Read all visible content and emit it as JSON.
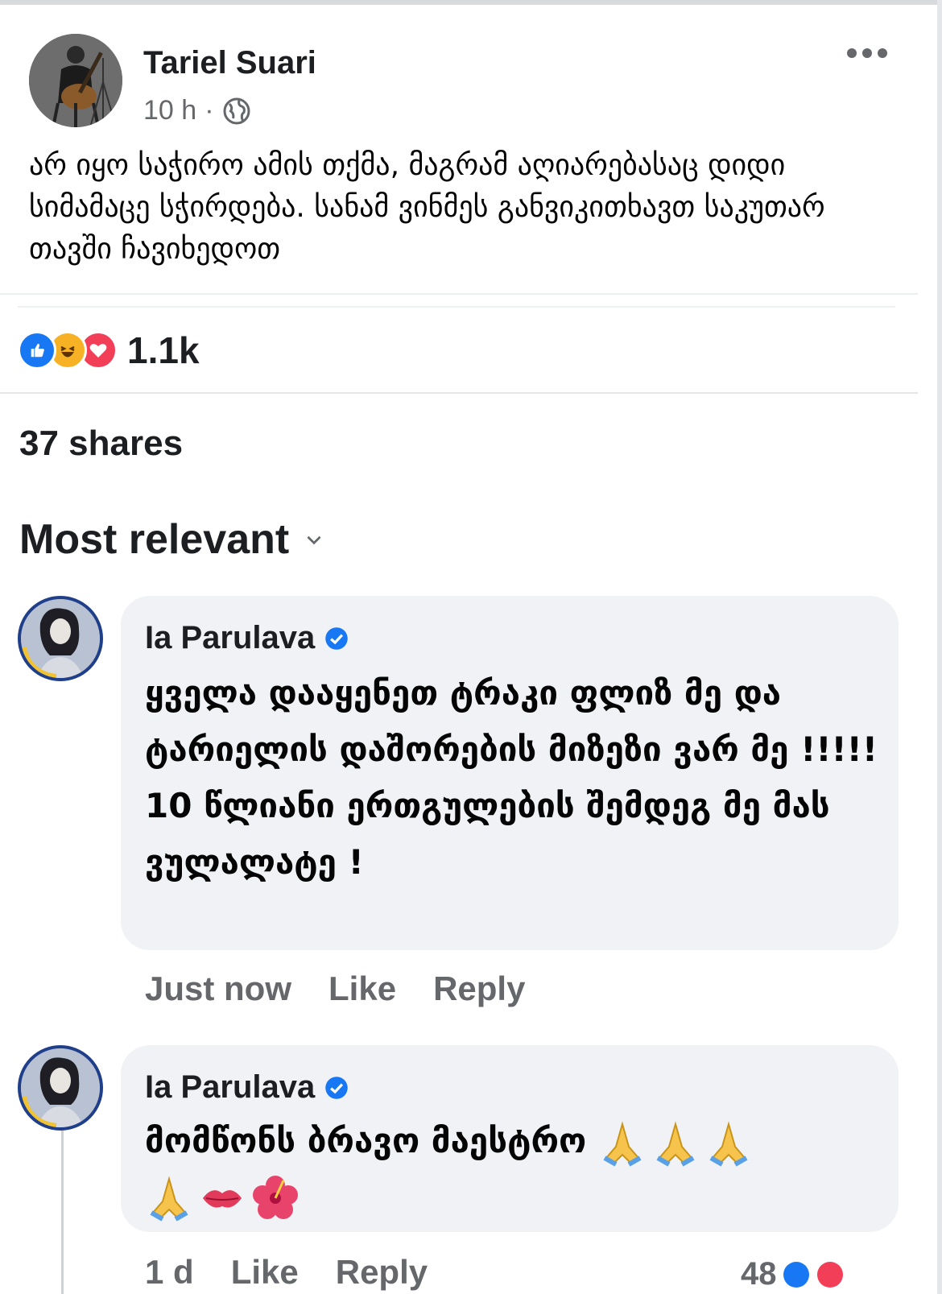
{
  "post": {
    "author": "Tariel Suari",
    "time": "10 h",
    "separator": "·",
    "privacy_icon": "globe-icon",
    "more_icon": "more-horizontal-icon",
    "text": "არ იყო საჭირო ამის თქმა, მაგრამ აღიარებასაც დიდი სიმამაცე სჭირდება. სანამ ვინმეს განვიკითხავთ საკუთარ თავში ჩავიხედოთ"
  },
  "reactions": {
    "icons": [
      "like-icon",
      "haha-icon",
      "love-icon"
    ],
    "count": "1.1k"
  },
  "shares": "37 shares",
  "sort": {
    "label": "Most relevant",
    "icon": "chevron-down-icon"
  },
  "comments": [
    {
      "name": "Ia Parulava",
      "verified": true,
      "text": "ყველა დააყენეთ ტრაკი ფლიზ მე და ტარიელის დაშორების მიზეზი ვარ მე !!!!! 10 წლიანი ერთგულების შემდეგ მე მას ვულალატე !",
      "time": "Just now",
      "like": "Like",
      "reply": "Reply"
    },
    {
      "name": "Ia Parulava",
      "verified": true,
      "text": "მომწონს ბრავო მაესტრო",
      "emojis": [
        "folded-hands-icon",
        "folded-hands-icon",
        "folded-hands-icon",
        "folded-hands-icon",
        "kiss-mark-icon",
        "hibiscus-icon"
      ],
      "time": "1 d",
      "like": "Like",
      "reply": "Reply",
      "reaction_count": "48"
    }
  ],
  "colors": {
    "like_blue": "#1877f2",
    "haha_yellow": "#f7b125",
    "love_red": "#f33e58",
    "bubble_bg": "#f0f2f5",
    "secondary_text": "#65676b"
  }
}
